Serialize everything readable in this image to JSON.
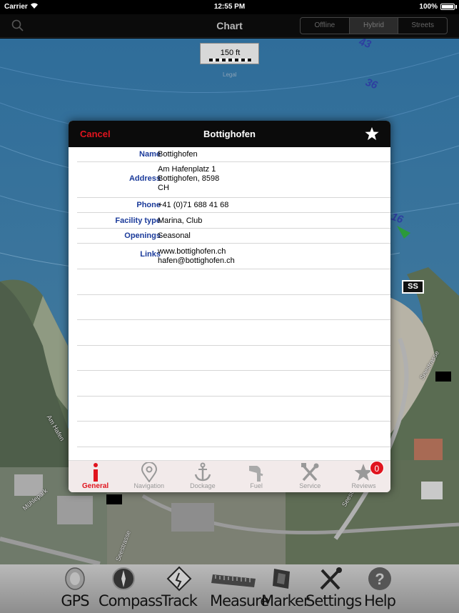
{
  "status_bar": {
    "carrier": "Carrier",
    "time": "12:55 PM",
    "battery": "100%"
  },
  "nav": {
    "title": "Chart",
    "segments": [
      "Offline",
      "Hybrid",
      "Streets"
    ],
    "selected_segment": "Hybrid"
  },
  "map": {
    "scale_label": "150 ft",
    "legal": "Legal",
    "depths": [
      "43",
      "36",
      "16"
    ],
    "mark": "SS",
    "streets": [
      "Seestrasse",
      "Seestrasse",
      "Am Hafen",
      "Mühlepark",
      "Seestrasse"
    ]
  },
  "modal": {
    "cancel": "Cancel",
    "title": "Bottighofen",
    "fields": [
      {
        "label": "Name",
        "value": "Bottighofen"
      },
      {
        "label": "Address",
        "value": "Am Hafenplatz 1\nBottighofen, 8598\nCH"
      },
      {
        "label": "Phone",
        "value": "+41 (0)71 688 41 68"
      },
      {
        "label": "Facility type",
        "value": "Marina, Club"
      },
      {
        "label": "Openings",
        "value": "Seasonal"
      },
      {
        "label": "Links",
        "value": "www.bottighofen.ch\nhafen@bottighofen.ch"
      }
    ],
    "tabs": [
      {
        "label": "General",
        "icon": "info-icon"
      },
      {
        "label": "Navigation",
        "icon": "location-pin-icon"
      },
      {
        "label": "Dockage",
        "icon": "anchor-icon"
      },
      {
        "label": "Fuel",
        "icon": "fuel-nozzle-icon"
      },
      {
        "label": "Service",
        "icon": "tools-icon"
      },
      {
        "label": "Reviews",
        "icon": "star-icon"
      }
    ],
    "active_tab": "General",
    "reviews_badge": "0"
  },
  "toolbar": {
    "items": [
      {
        "label": "GPS",
        "icon": "gps-icon"
      },
      {
        "label": "Compass",
        "icon": "compass-icon"
      },
      {
        "label": "Track",
        "icon": "track-icon"
      },
      {
        "label": "Measure",
        "icon": "ruler-icon"
      },
      {
        "label": "Marker",
        "icon": "marker-icon"
      },
      {
        "label": "Settings",
        "icon": "settings-icon"
      },
      {
        "label": "Help",
        "icon": "help-icon"
      }
    ]
  },
  "colors": {
    "accent_red": "#e0141e",
    "label_blue": "#1a3a9a",
    "water": "#3c6c8c"
  }
}
